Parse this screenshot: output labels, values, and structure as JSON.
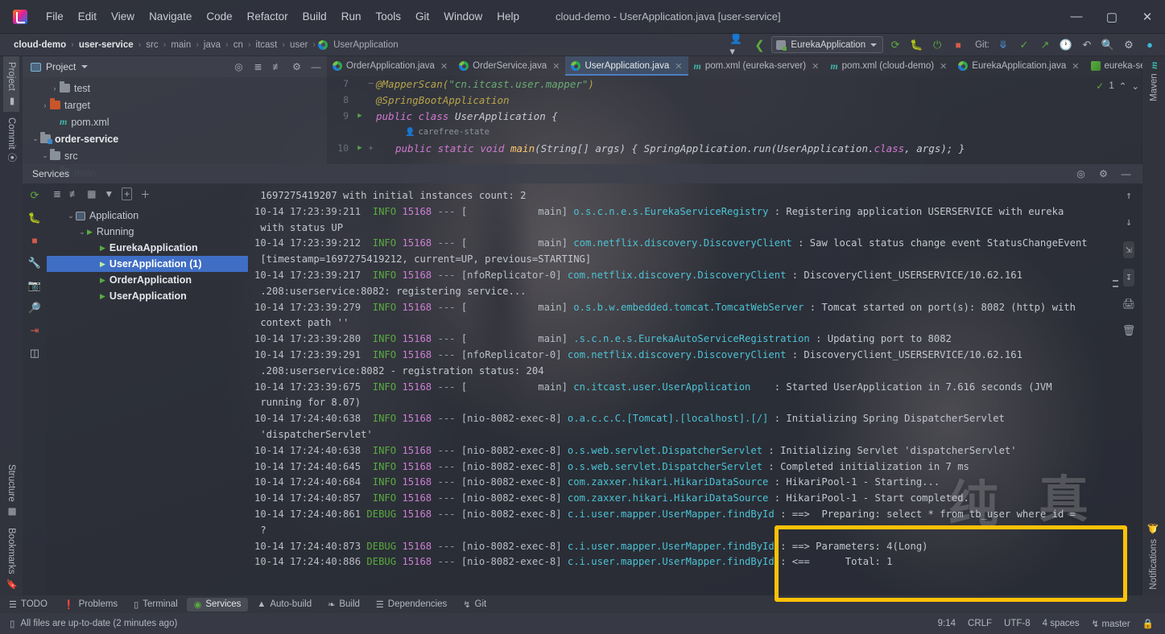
{
  "window": {
    "title": "cloud-demo - UserApplication.java [user-service]",
    "minimize": "—",
    "maximize": "▢",
    "close": "✕"
  },
  "menu": {
    "items": [
      "File",
      "Edit",
      "View",
      "Navigate",
      "Code",
      "Refactor",
      "Build",
      "Run",
      "Tools",
      "Git",
      "Window",
      "Help"
    ]
  },
  "breadcrumb": {
    "items": [
      "cloud-demo",
      "user-service",
      "src",
      "main",
      "java",
      "cn",
      "itcast",
      "user",
      "UserApplication"
    ],
    "separator": "›"
  },
  "toolbar": {
    "run_config": "EurekaApplication",
    "git_label": "Git:",
    "icons": {
      "profile": "user-switch-icon",
      "back": "navigate-back-icon",
      "run": "run-icon",
      "debug": "debug-icon",
      "run_coverage": "run-with-coverage-icon",
      "stop": "stop-icon",
      "update": "git-update-icon",
      "commit": "git-commit-icon",
      "push": "git-push-icon",
      "history": "git-history-icon",
      "rollback": "git-rollback-icon",
      "search": "search-everywhere-icon",
      "settings": "settings-icon",
      "account": "account-icon"
    }
  },
  "project_panel": {
    "title": "Project",
    "tree": [
      {
        "label": "test",
        "indent": 3,
        "twisty": "›",
        "icon": "folder",
        "bold": false
      },
      {
        "label": "target",
        "indent": 2,
        "twisty": "›",
        "icon": "folder-orange",
        "bold": false
      },
      {
        "label": "pom.xml",
        "indent": 3,
        "twisty": "",
        "icon": "maven",
        "bold": false
      },
      {
        "label": "order-service",
        "indent": 1,
        "twisty": "⌄",
        "icon": "folder-module",
        "bold": true
      },
      {
        "label": "src",
        "indent": 2,
        "twisty": "⌄",
        "icon": "folder",
        "bold": false
      },
      {
        "label": "main",
        "indent": 3,
        "twisty": "⌄",
        "icon": "folder",
        "bold": false
      }
    ]
  },
  "editor_tabs": [
    {
      "label": "OrderApplication.java",
      "icon": "java-class-icon",
      "active": false
    },
    {
      "label": "OrderService.java",
      "icon": "java-class-icon",
      "active": false
    },
    {
      "label": "UserApplication.java",
      "icon": "java-class-icon",
      "active": true
    },
    {
      "label": "pom.xml (eureka-server)",
      "icon": "maven-icon",
      "active": false
    },
    {
      "label": "pom.xml (cloud-demo)",
      "icon": "maven-icon",
      "active": false
    },
    {
      "label": "EurekaApplication.java",
      "icon": "java-class-icon",
      "active": false
    },
    {
      "label": "eureka-server\\",
      "icon": "service-icon",
      "active": false
    }
  ],
  "editor": {
    "inspection_count": "1",
    "author_hint": "carefree-state",
    "lines": [
      {
        "num": "7",
        "runnable": false,
        "fold": "─"
      },
      {
        "num": "8",
        "runnable": false,
        "fold": ""
      },
      {
        "num": "9",
        "runnable": true,
        "fold": ""
      },
      {
        "num": "10",
        "runnable": true,
        "fold": "+"
      }
    ],
    "code": {
      "l7_ann": "@MapperScan(",
      "l7_str": "\"cn.itcast.user.mapper\"",
      "l7_end": ")",
      "l8": "@SpringBootApplication",
      "l9_kw": "public class ",
      "l9_name": "UserApplication ",
      "l9_brace": "{",
      "l10_kw": "public static void ",
      "l10_meth": "main",
      "l10_args": "(String[] args) ",
      "l10_body": "{ SpringApplication.run(UserApplication.",
      "l10_cls": "class",
      "l10_tail": ", args); }"
    }
  },
  "services": {
    "title": "Services",
    "tree": [
      {
        "label": "Application",
        "indent": 1,
        "twisty": "⌄",
        "icon": "application-icon",
        "bold": false,
        "selected": false
      },
      {
        "label": "Running",
        "indent": 2,
        "twisty": "⌄",
        "icon": "play-icon",
        "bold": false,
        "selected": false
      },
      {
        "label": "EurekaApplication",
        "indent": 3,
        "twisty": "",
        "icon": "play-icon",
        "bold": true,
        "selected": false
      },
      {
        "label": "UserApplication (1)",
        "indent": 3,
        "twisty": "",
        "icon": "play-icon",
        "bold": true,
        "selected": true
      },
      {
        "label": "OrderApplication",
        "indent": 3,
        "twisty": "",
        "icon": "play-icon",
        "bold": true,
        "selected": false
      },
      {
        "label": "UserApplication",
        "indent": 3,
        "twisty": "",
        "icon": "play-icon",
        "bold": true,
        "selected": false
      }
    ],
    "toolbar_icons": [
      "expand-all-icon",
      "collapse-all-icon",
      "group-by-icon",
      "filter-icon",
      "add-tab-icon",
      "add-service-icon"
    ],
    "runbar_icons": [
      "rerun-icon",
      "debug-icon",
      "stop-icon",
      "settings-wrench-icon",
      "screenshot-icon",
      "attach-debugger-icon",
      "export-icon",
      "layout-icon"
    ],
    "console_action_icons": [
      "scroll-up-icon",
      "scroll-down-icon",
      "soft-wrap-icon",
      "scroll-to-end-icon",
      "print-icon",
      "clear-all-icon"
    ]
  },
  "console_log": [
    {
      "cont": true,
      "text": "1697275419207 with initial instances count: 2"
    },
    {
      "ts": "10-14 17:23:39:211",
      "level": "INFO",
      "pid": "15168",
      "thread": "main",
      "thread_pad": 12,
      "logger": "o.s.c.n.e.s.EurekaServiceRegistry",
      "logger_pad": 33,
      "msg": ": Registering application USERSERVICE with eureka"
    },
    {
      "cont": true,
      "text": "with status UP"
    },
    {
      "ts": "10-14 17:23:39:212",
      "level": "INFO",
      "pid": "15168",
      "thread": "main",
      "thread_pad": 12,
      "logger": "com.netflix.discovery.DiscoveryClient",
      "logger_pad": 33,
      "msg": ": Saw local status change event StatusChangeEvent"
    },
    {
      "cont": true,
      "text": "[timestamp=1697275419212, current=UP, previous=STARTING]"
    },
    {
      "ts": "10-14 17:23:39:217",
      "level": "INFO",
      "pid": "15168",
      "thread": "nfoReplicator-0",
      "thread_pad": 0,
      "logger": "com.netflix.discovery.DiscoveryClient",
      "logger_pad": 33,
      "msg": ": DiscoveryClient_USERSERVICE/10.62.161"
    },
    {
      "cont": true,
      "text": ".208:userservice:8082: registering service..."
    },
    {
      "ts": "10-14 17:23:39:279",
      "level": "INFO",
      "pid": "15168",
      "thread": "main",
      "thread_pad": 12,
      "logger": "o.s.b.w.embedded.tomcat.TomcatWebServer",
      "logger_pad": 33,
      "msg": ": Tomcat started on port(s): 8082 (http) with"
    },
    {
      "cont": true,
      "text": "context path ''"
    },
    {
      "ts": "10-14 17:23:39:280",
      "level": "INFO",
      "pid": "15168",
      "thread": "main",
      "thread_pad": 12,
      "logger": ".s.c.n.e.s.EurekaAutoServiceRegistration",
      "logger_pad": 33,
      "msg": ": Updating port to 8082"
    },
    {
      "ts": "10-14 17:23:39:291",
      "level": "INFO",
      "pid": "15168",
      "thread": "nfoReplicator-0",
      "thread_pad": 0,
      "logger": "com.netflix.discovery.DiscoveryClient",
      "logger_pad": 33,
      "msg": ": DiscoveryClient_USERSERVICE/10.62.161"
    },
    {
      "cont": true,
      "text": ".208:userservice:8082 - registration status: 204"
    },
    {
      "ts": "10-14 17:23:39:675",
      "level": "INFO",
      "pid": "15168",
      "thread": "main",
      "thread_pad": 12,
      "logger": "cn.itcast.user.UserApplication",
      "logger_pad": 33,
      "msg": ": Started UserApplication in 7.616 seconds (JVM"
    },
    {
      "cont": true,
      "text": "running for 8.07)"
    },
    {
      "ts": "10-14 17:24:40:638",
      "level": "INFO",
      "pid": "15168",
      "thread": "nio-8082-exec-8",
      "thread_pad": 0,
      "logger": "o.a.c.c.C.[Tomcat].[localhost].[/]",
      "logger_pad": 33,
      "msg": ": Initializing Spring DispatcherServlet"
    },
    {
      "cont": true,
      "text": "'dispatcherServlet'"
    },
    {
      "ts": "10-14 17:24:40:638",
      "level": "INFO",
      "pid": "15168",
      "thread": "nio-8082-exec-8",
      "thread_pad": 0,
      "logger": "o.s.web.servlet.DispatcherServlet",
      "logger_pad": 33,
      "msg": ": Initializing Servlet 'dispatcherServlet'"
    },
    {
      "ts": "10-14 17:24:40:645",
      "level": "INFO",
      "pid": "15168",
      "thread": "nio-8082-exec-8",
      "thread_pad": 0,
      "logger": "o.s.web.servlet.DispatcherServlet",
      "logger_pad": 33,
      "msg": ": Completed initialization in 7 ms"
    },
    {
      "ts": "10-14 17:24:40:684",
      "level": "INFO",
      "pid": "15168",
      "thread": "nio-8082-exec-8",
      "thread_pad": 0,
      "logger": "com.zaxxer.hikari.HikariDataSource",
      "logger_pad": 33,
      "msg": ": HikariPool-1 - Starting..."
    },
    {
      "ts": "10-14 17:24:40:857",
      "level": "INFO",
      "pid": "15168",
      "thread": "nio-8082-exec-8",
      "thread_pad": 0,
      "logger": "com.zaxxer.hikari.HikariDataSource",
      "logger_pad": 33,
      "msg": ": HikariPool-1 - Start completed."
    },
    {
      "ts": "10-14 17:24:40:861",
      "level": "DEBUG",
      "pid": "15168",
      "thread": "nio-8082-exec-8",
      "thread_pad": 0,
      "logger": "c.i.user.mapper.UserMapper.findById",
      "logger_pad": 33,
      "msg": ": ==>  Preparing: select * from tb_user where id ="
    },
    {
      "cont": true,
      "text": "?"
    },
    {
      "ts": "10-14 17:24:40:873",
      "level": "DEBUG",
      "pid": "15168",
      "thread": "nio-8082-exec-8",
      "thread_pad": 0,
      "logger": "c.i.user.mapper.UserMapper.findById",
      "logger_pad": 33,
      "msg": ": ==> Parameters: 4(Long)"
    },
    {
      "ts": "10-14 17:24:40:886",
      "level": "DEBUG",
      "pid": "15168",
      "thread": "nio-8082-exec-8",
      "thread_pad": 0,
      "logger": "c.i.user.mapper.UserMapper.findById",
      "logger_pad": 33,
      "msg": ": <==      Total: 1"
    }
  ],
  "highlight": {
    "color": "#ffc107",
    "note": "annotation box around SQL parameters and total rows"
  },
  "bottom_bar": {
    "items": [
      {
        "label": "TODO",
        "icon": "todo-icon",
        "active": false
      },
      {
        "label": "Problems",
        "icon": "problems-icon",
        "active": false
      },
      {
        "label": "Terminal",
        "icon": "terminal-icon",
        "active": false
      },
      {
        "label": "Services",
        "icon": "services-icon",
        "active": true
      },
      {
        "label": "Auto-build",
        "icon": "auto-build-icon",
        "active": false
      },
      {
        "label": "Build",
        "icon": "build-icon",
        "active": false
      },
      {
        "label": "Dependencies",
        "icon": "dependencies-icon",
        "active": false
      },
      {
        "label": "Git",
        "icon": "git-branch-icon",
        "active": false
      }
    ]
  },
  "status_bar": {
    "message": "All files are up-to-date (2 minutes ago)",
    "caret": "9:14",
    "line_sep": "CRLF",
    "encoding": "UTF-8",
    "indent": "4 spaces",
    "branch": "master",
    "lock_icon": "lock-icon"
  },
  "side_stripes": {
    "left_top": [
      {
        "label": "Project",
        "icon": "project-icon",
        "active": true
      },
      {
        "label": "Commit",
        "icon": "commit-icon",
        "active": false
      }
    ],
    "left_bottom": [
      {
        "label": "Structure",
        "icon": "structure-icon",
        "active": false
      },
      {
        "label": "Bookmarks",
        "icon": "bookmarks-icon",
        "active": false
      }
    ],
    "right_top": [
      {
        "label": "Maven",
        "icon": "maven-icon",
        "active": false
      }
    ],
    "right_bottom": [
      {
        "label": "Notifications",
        "icon": "notifications-icon",
        "active": false
      }
    ]
  },
  "wallpaper_text": {
    "kanji1": "纯",
    "kanji2": "真"
  }
}
